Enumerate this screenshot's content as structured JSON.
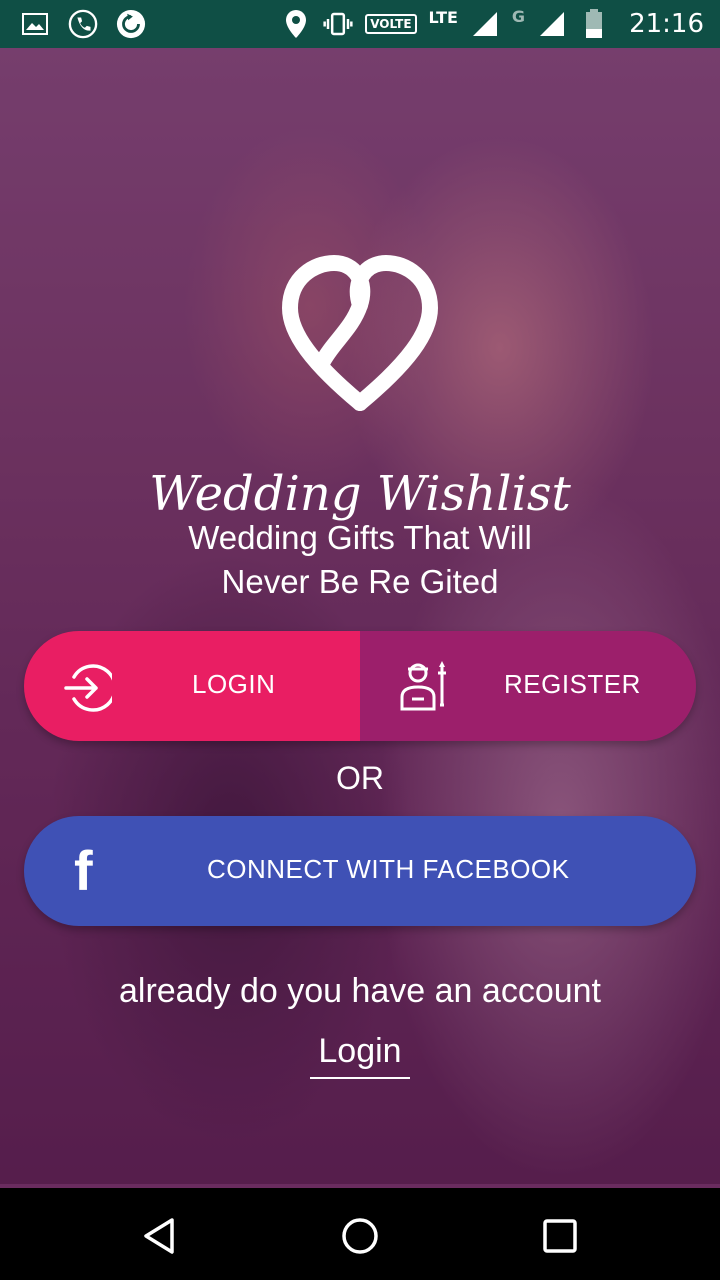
{
  "status_bar": {
    "volte": "VOLTE",
    "network_lte": "LTE",
    "network_g": "G",
    "time": "21:16",
    "left_icons": [
      "image-icon",
      "call-icon",
      "sync-icon"
    ],
    "right_icons": [
      "location-icon",
      "vibrate-icon",
      "signal-icon",
      "battery-icon"
    ]
  },
  "app": {
    "brand_name": "Wedding Wishlist",
    "tagline_line1": "Wedding Gifts That Will",
    "tagline_line2": "Never Be Re Gited"
  },
  "buttons": {
    "login_label": "LOGIN",
    "register_label": "REGISTER",
    "or_label": "OR",
    "facebook_label": "CONNECT WITH FACEBOOK",
    "facebook_glyph": "f"
  },
  "footer": {
    "prompt": "already do you have an account",
    "login_link": "Login"
  },
  "colors": {
    "status_bar": "#0f4f45",
    "login": "#e91e63",
    "register": "#9c1f6b",
    "facebook": "#3f51b5"
  }
}
